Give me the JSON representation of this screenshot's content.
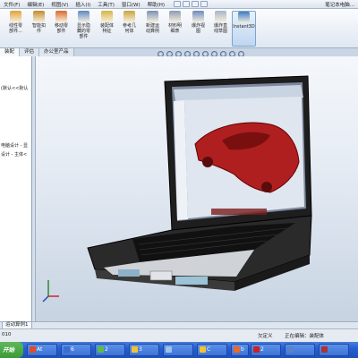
{
  "menubar": {
    "items": [
      "文件(F)",
      "编辑(E)",
      "视图(V)",
      "插入(I)",
      "工具(T)",
      "窗口(W)",
      "帮助(H)"
    ],
    "doc_title": "笔记本电脑..."
  },
  "ribbon": {
    "buttons": [
      {
        "label": "线性零\n部件...",
        "icon": "linear-pattern-icon",
        "color": "#e2a23a"
      },
      {
        "label": "智能扣\n件",
        "icon": "smart-fastener-icon",
        "color": "#c28b2c"
      },
      {
        "label": "移动零\n部件",
        "icon": "move-component-icon",
        "color": "#d96a2a"
      },
      {
        "label": "显示隐\n藏的零\n部件",
        "icon": "show-hidden-icon",
        "color": "#5f86c4"
      },
      {
        "label": "装配体\n特征",
        "icon": "assembly-feature-icon",
        "color": "#d6b545"
      },
      {
        "label": "参考几\n何体",
        "icon": "reference-geometry-icon",
        "color": "#c9a441"
      },
      {
        "label": "新建运\n动算例",
        "icon": "new-motion-study-icon",
        "color": "#7a8fb5"
      },
      {
        "label": "材料明\n细表",
        "icon": "bom-icon",
        "color": "#8c9bb3"
      },
      {
        "label": "爆炸视\n图",
        "icon": "exploded-view-icon",
        "color": "#6c8abf"
      },
      {
        "label": "爆炸直\n线草图",
        "icon": "explode-line-icon",
        "color": "#a7b4c7"
      },
      {
        "label": "Instant3D",
        "icon": "instant3d-icon",
        "color": "#3c7ec4"
      }
    ]
  },
  "tabs": [
    "装配",
    "评估",
    "办公室产品"
  ],
  "feature_tree": {
    "items": [
      "(默认<<默认",
      "电脑设计 - 显",
      "设计 - 主体<"
    ]
  },
  "tree_tabs": [
    "运动算例1"
  ],
  "status": {
    "left": "010",
    "mid": "欠定义",
    "right": "正在编辑：装配体"
  },
  "taskbar": {
    "buttons": [
      {
        "label": "At",
        "icon_color": "#e24a2a"
      },
      {
        "label": "6",
        "icon_color": "#3a6ed0"
      },
      {
        "label": "2",
        "icon_color": "#5bbd44"
      },
      {
        "label": "3",
        "icon_color": "#f1c232"
      },
      {
        "label": "",
        "icon_color": "#9dc3e6"
      },
      {
        "label": "C",
        "icon_color": "#f1c232"
      },
      {
        "label": "b",
        "icon_color": "#e86a2a"
      },
      {
        "label": "2",
        "icon_color": "#cc2222"
      },
      {
        "label": "",
        "icon_color": "#5a82c8"
      },
      {
        "label": "",
        "icon_color": "#aa3333"
      }
    ]
  },
  "colors": {
    "car_body": "#b01f1f",
    "laptop_shell": "#2a2a2a",
    "viewport_bg": "#e6ecf4"
  }
}
